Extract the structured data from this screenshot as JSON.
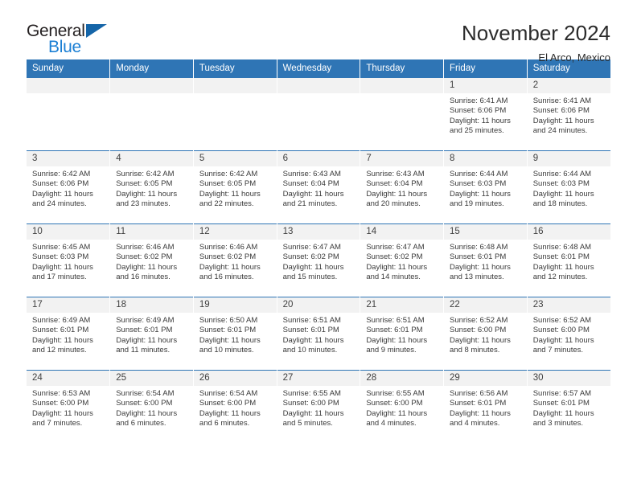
{
  "brand": {
    "name_top": "General",
    "name_bottom": "Blue",
    "accent_color": "#1b7fd4",
    "triangle_color": "#1565a8"
  },
  "header": {
    "title": "November 2024",
    "subtitle": "El Arco, Mexico",
    "header_bg": "#2f75b5",
    "daynum_bg": "#f2f2f2"
  },
  "weekdays": [
    "Sunday",
    "Monday",
    "Tuesday",
    "Wednesday",
    "Thursday",
    "Friday",
    "Saturday"
  ],
  "labels": {
    "sunrise_prefix": "Sunrise:",
    "sunset_prefix": "Sunset:",
    "daylight_prefix": "Daylight:"
  },
  "weeks": [
    [
      {
        "empty": true
      },
      {
        "empty": true
      },
      {
        "empty": true
      },
      {
        "empty": true
      },
      {
        "empty": true
      },
      {
        "day": "1",
        "sunrise": "Sunrise: 6:41 AM",
        "sunset": "Sunset: 6:06 PM",
        "daylight_line1": "Daylight: 11 hours",
        "daylight_line2": "and 25 minutes."
      },
      {
        "day": "2",
        "sunrise": "Sunrise: 6:41 AM",
        "sunset": "Sunset: 6:06 PM",
        "daylight_line1": "Daylight: 11 hours",
        "daylight_line2": "and 24 minutes."
      }
    ],
    [
      {
        "day": "3",
        "sunrise": "Sunrise: 6:42 AM",
        "sunset": "Sunset: 6:06 PM",
        "daylight_line1": "Daylight: 11 hours",
        "daylight_line2": "and 24 minutes."
      },
      {
        "day": "4",
        "sunrise": "Sunrise: 6:42 AM",
        "sunset": "Sunset: 6:05 PM",
        "daylight_line1": "Daylight: 11 hours",
        "daylight_line2": "and 23 minutes."
      },
      {
        "day": "5",
        "sunrise": "Sunrise: 6:42 AM",
        "sunset": "Sunset: 6:05 PM",
        "daylight_line1": "Daylight: 11 hours",
        "daylight_line2": "and 22 minutes."
      },
      {
        "day": "6",
        "sunrise": "Sunrise: 6:43 AM",
        "sunset": "Sunset: 6:04 PM",
        "daylight_line1": "Daylight: 11 hours",
        "daylight_line2": "and 21 minutes."
      },
      {
        "day": "7",
        "sunrise": "Sunrise: 6:43 AM",
        "sunset": "Sunset: 6:04 PM",
        "daylight_line1": "Daylight: 11 hours",
        "daylight_line2": "and 20 minutes."
      },
      {
        "day": "8",
        "sunrise": "Sunrise: 6:44 AM",
        "sunset": "Sunset: 6:03 PM",
        "daylight_line1": "Daylight: 11 hours",
        "daylight_line2": "and 19 minutes."
      },
      {
        "day": "9",
        "sunrise": "Sunrise: 6:44 AM",
        "sunset": "Sunset: 6:03 PM",
        "daylight_line1": "Daylight: 11 hours",
        "daylight_line2": "and 18 minutes."
      }
    ],
    [
      {
        "day": "10",
        "sunrise": "Sunrise: 6:45 AM",
        "sunset": "Sunset: 6:03 PM",
        "daylight_line1": "Daylight: 11 hours",
        "daylight_line2": "and 17 minutes."
      },
      {
        "day": "11",
        "sunrise": "Sunrise: 6:46 AM",
        "sunset": "Sunset: 6:02 PM",
        "daylight_line1": "Daylight: 11 hours",
        "daylight_line2": "and 16 minutes."
      },
      {
        "day": "12",
        "sunrise": "Sunrise: 6:46 AM",
        "sunset": "Sunset: 6:02 PM",
        "daylight_line1": "Daylight: 11 hours",
        "daylight_line2": "and 16 minutes."
      },
      {
        "day": "13",
        "sunrise": "Sunrise: 6:47 AM",
        "sunset": "Sunset: 6:02 PM",
        "daylight_line1": "Daylight: 11 hours",
        "daylight_line2": "and 15 minutes."
      },
      {
        "day": "14",
        "sunrise": "Sunrise: 6:47 AM",
        "sunset": "Sunset: 6:02 PM",
        "daylight_line1": "Daylight: 11 hours",
        "daylight_line2": "and 14 minutes."
      },
      {
        "day": "15",
        "sunrise": "Sunrise: 6:48 AM",
        "sunset": "Sunset: 6:01 PM",
        "daylight_line1": "Daylight: 11 hours",
        "daylight_line2": "and 13 minutes."
      },
      {
        "day": "16",
        "sunrise": "Sunrise: 6:48 AM",
        "sunset": "Sunset: 6:01 PM",
        "daylight_line1": "Daylight: 11 hours",
        "daylight_line2": "and 12 minutes."
      }
    ],
    [
      {
        "day": "17",
        "sunrise": "Sunrise: 6:49 AM",
        "sunset": "Sunset: 6:01 PM",
        "daylight_line1": "Daylight: 11 hours",
        "daylight_line2": "and 12 minutes."
      },
      {
        "day": "18",
        "sunrise": "Sunrise: 6:49 AM",
        "sunset": "Sunset: 6:01 PM",
        "daylight_line1": "Daylight: 11 hours",
        "daylight_line2": "and 11 minutes."
      },
      {
        "day": "19",
        "sunrise": "Sunrise: 6:50 AM",
        "sunset": "Sunset: 6:01 PM",
        "daylight_line1": "Daylight: 11 hours",
        "daylight_line2": "and 10 minutes."
      },
      {
        "day": "20",
        "sunrise": "Sunrise: 6:51 AM",
        "sunset": "Sunset: 6:01 PM",
        "daylight_line1": "Daylight: 11 hours",
        "daylight_line2": "and 10 minutes."
      },
      {
        "day": "21",
        "sunrise": "Sunrise: 6:51 AM",
        "sunset": "Sunset: 6:01 PM",
        "daylight_line1": "Daylight: 11 hours",
        "daylight_line2": "and 9 minutes."
      },
      {
        "day": "22",
        "sunrise": "Sunrise: 6:52 AM",
        "sunset": "Sunset: 6:00 PM",
        "daylight_line1": "Daylight: 11 hours",
        "daylight_line2": "and 8 minutes."
      },
      {
        "day": "23",
        "sunrise": "Sunrise: 6:52 AM",
        "sunset": "Sunset: 6:00 PM",
        "daylight_line1": "Daylight: 11 hours",
        "daylight_line2": "and 7 minutes."
      }
    ],
    [
      {
        "day": "24",
        "sunrise": "Sunrise: 6:53 AM",
        "sunset": "Sunset: 6:00 PM",
        "daylight_line1": "Daylight: 11 hours",
        "daylight_line2": "and 7 minutes."
      },
      {
        "day": "25",
        "sunrise": "Sunrise: 6:54 AM",
        "sunset": "Sunset: 6:00 PM",
        "daylight_line1": "Daylight: 11 hours",
        "daylight_line2": "and 6 minutes."
      },
      {
        "day": "26",
        "sunrise": "Sunrise: 6:54 AM",
        "sunset": "Sunset: 6:00 PM",
        "daylight_line1": "Daylight: 11 hours",
        "daylight_line2": "and 6 minutes."
      },
      {
        "day": "27",
        "sunrise": "Sunrise: 6:55 AM",
        "sunset": "Sunset: 6:00 PM",
        "daylight_line1": "Daylight: 11 hours",
        "daylight_line2": "and 5 minutes."
      },
      {
        "day": "28",
        "sunrise": "Sunrise: 6:55 AM",
        "sunset": "Sunset: 6:00 PM",
        "daylight_line1": "Daylight: 11 hours",
        "daylight_line2": "and 4 minutes."
      },
      {
        "day": "29",
        "sunrise": "Sunrise: 6:56 AM",
        "sunset": "Sunset: 6:01 PM",
        "daylight_line1": "Daylight: 11 hours",
        "daylight_line2": "and 4 minutes."
      },
      {
        "day": "30",
        "sunrise": "Sunrise: 6:57 AM",
        "sunset": "Sunset: 6:01 PM",
        "daylight_line1": "Daylight: 11 hours",
        "daylight_line2": "and 3 minutes."
      }
    ]
  ]
}
